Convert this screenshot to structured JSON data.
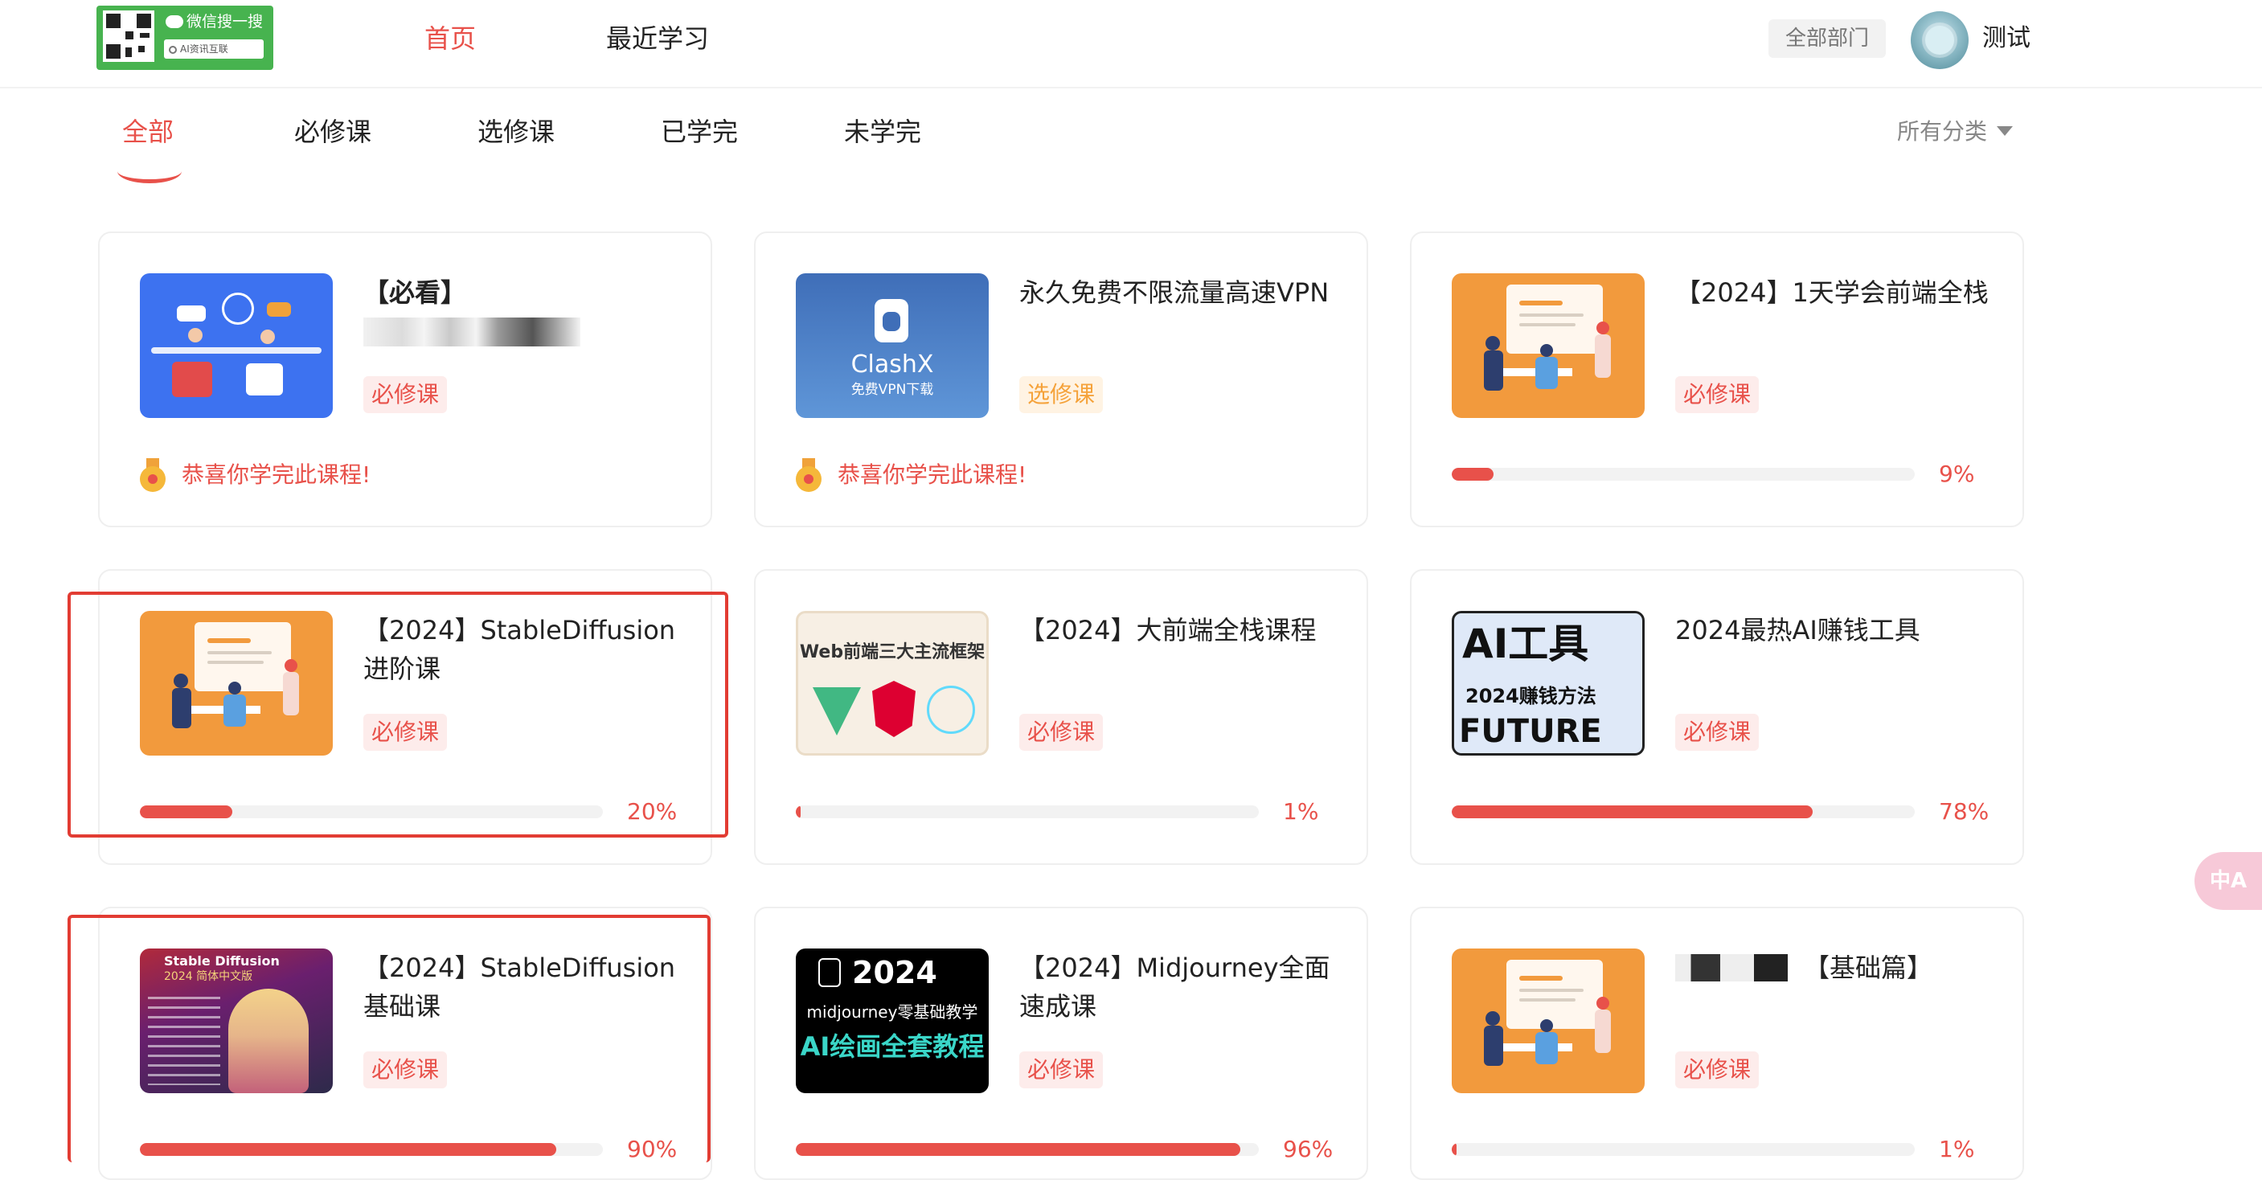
{
  "brand": {
    "logo_line1": "微信搜一搜",
    "logo_search": "AI资讯互联"
  },
  "nav": {
    "home": "首页",
    "recent": "最近学习",
    "department": "全部部门",
    "username": "测试"
  },
  "tabs": [
    {
      "label": "全部",
      "active": true
    },
    {
      "label": "必修课",
      "active": false
    },
    {
      "label": "选修课",
      "active": false
    },
    {
      "label": "已学完",
      "active": false
    },
    {
      "label": "未学完",
      "active": false
    }
  ],
  "category_filter": "所有分类",
  "courses": [
    {
      "title": "【必看】",
      "tag": "必修课",
      "status": "completed",
      "done_text": "恭喜你学完此课程!",
      "thumb": "office-illustration-icon",
      "title_blurred": true
    },
    {
      "title": "永久免费不限流量高速VPN",
      "tag": "选修课",
      "status": "completed",
      "done_text": "恭喜你学完此课程!",
      "thumb": "clashx-vpn-icon",
      "thumb_text": "ClashX",
      "thumb_sub": "免费VPN下载"
    },
    {
      "title": "【2024】1天学会前端全栈",
      "tag": "必修课",
      "progress": 9,
      "progress_label": "9%",
      "thumb": "presentation-illustration-icon"
    },
    {
      "title": "【2024】StableDiffusion进阶课",
      "tag": "必修课",
      "progress": 20,
      "progress_label": "20%",
      "thumb": "presentation-illustration-icon",
      "highlighted": true
    },
    {
      "title": "【2024】大前端全栈课程",
      "tag": "必修课",
      "progress": 1,
      "progress_label": "1%",
      "thumb": "web-frameworks-icon",
      "thumb_text": "Web前端三大主流框架"
    },
    {
      "title": "2024最热AI赚钱工具",
      "tag": "必修课",
      "progress": 78,
      "progress_label": "78%",
      "thumb": "ai-tools-icon",
      "thumb_text": "AI工具",
      "thumb_sub": "2024赚钱方法",
      "thumb_sub2": "FUTURE"
    },
    {
      "title": "【2024】StableDiffusion基础课",
      "tag": "必修课",
      "progress": 90,
      "progress_label": "90%",
      "thumb": "stable-diffusion-cover-icon",
      "thumb_text": "Stable Diffusion",
      "thumb_sub": "2024 简体中文版",
      "highlighted": true
    },
    {
      "title": "【2024】Midjourney全面速成课",
      "tag": "必修课",
      "progress": 96,
      "progress_label": "96%",
      "thumb": "midjourney-cover-icon",
      "thumb_text": "2024",
      "thumb_sub": "midjourney零基础教学",
      "thumb_sub2": "AI绘画全套教程"
    },
    {
      "title": "【基础篇】",
      "tag": "必修课",
      "progress": 1,
      "progress_label": "1%",
      "thumb": "presentation-illustration-icon",
      "title_blurred": true
    }
  ],
  "colors": {
    "accent": "#e8514a",
    "elective": "#f5a23a",
    "highlight_box": "#e23c33",
    "logo_green": "#47b34f"
  },
  "floating_button": "中A"
}
